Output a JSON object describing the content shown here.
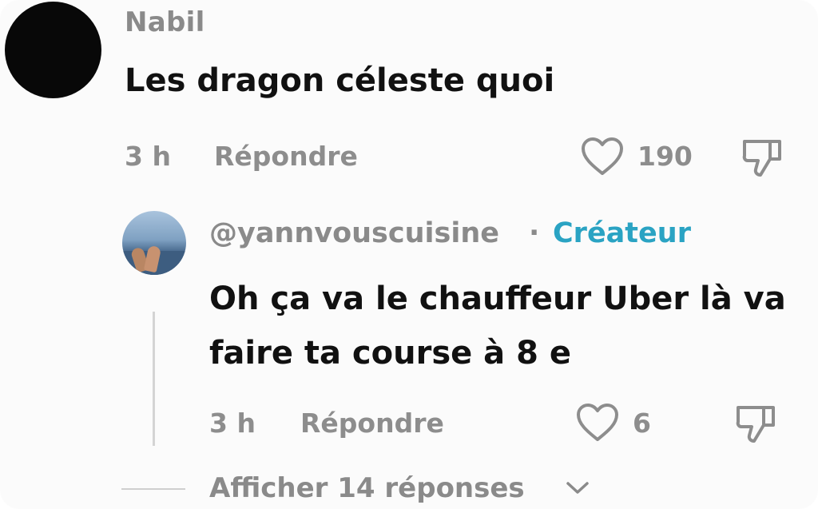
{
  "comment": {
    "username": "Nabil",
    "text": "Les dragon céleste quoi",
    "time": "3 h",
    "reply_label": "Répondre",
    "likes": "190"
  },
  "reply": {
    "username": "@yannvouscuisine",
    "separator": "·",
    "badge": "Créateur",
    "text": "Oh ça va le chauffeur Uber là va faire ta course à 8 e",
    "time": "3 h",
    "reply_label": "Répondre",
    "likes": "6"
  },
  "show_replies": {
    "label": "Afficher 14 réponses"
  },
  "colors": {
    "creator_accent": "#2aa3c3",
    "muted_text": "#8a8a8a",
    "primary_text": "#111111"
  },
  "icons": {
    "like": "heart-outline-icon",
    "dislike": "thumbs-down-icon",
    "expand": "chevron-down-icon"
  }
}
